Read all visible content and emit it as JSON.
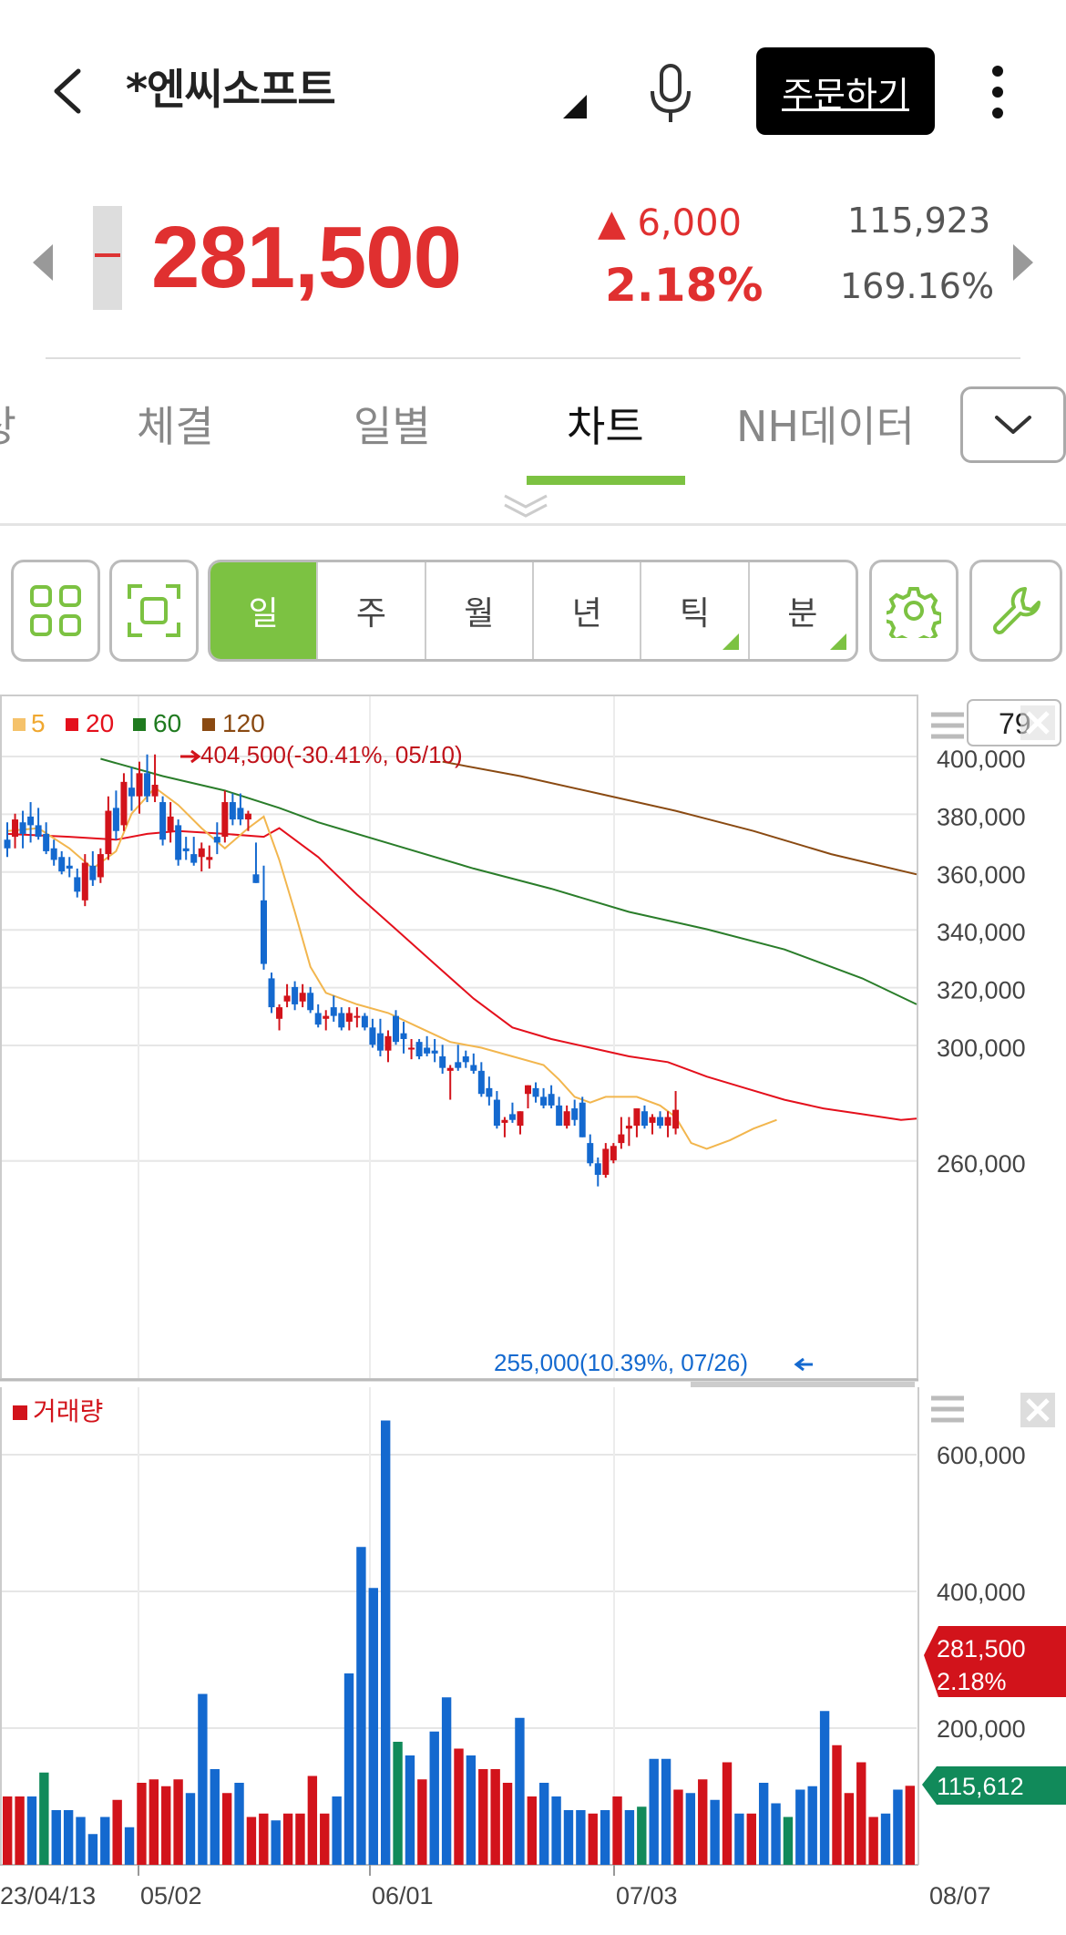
{
  "header": {
    "stock_name": "*엔씨소프트",
    "order_label": "주문하기"
  },
  "quote": {
    "price": "281,500",
    "change": "▲ 6,000",
    "change_rate": "2.18%",
    "volume": "115,923",
    "volume_rate": "169.16%"
  },
  "tabs": [
    "상",
    "체결",
    "일별",
    "차트",
    "NH데이터"
  ],
  "active_tab": "차트",
  "toolbar": {
    "periods": [
      {
        "label": "일",
        "active": true,
        "corner": false
      },
      {
        "label": "주",
        "active": false,
        "corner": false
      },
      {
        "label": "월",
        "active": false,
        "corner": false
      },
      {
        "label": "년",
        "active": false,
        "corner": false
      },
      {
        "label": "틱",
        "active": false,
        "corner": true
      },
      {
        "label": "분",
        "active": false,
        "corner": true
      }
    ]
  },
  "colors": {
    "up": "#d2131b",
    "down": "#1469cf",
    "accent": "#7cc242",
    "ma5": "#f2b64e",
    "ma20": "#e4101c",
    "ma60": "#2a7d2a",
    "ma120": "#8a4a12"
  },
  "chart_data": [
    {
      "type": "candlestick",
      "legend": [
        {
          "label": "5",
          "color": "#f5c26b"
        },
        {
          "label": "20",
          "color": "#e4101c"
        },
        {
          "label": "60",
          "color": "#1f7a1f"
        },
        {
          "label": "120",
          "color": "#8a4a12"
        }
      ],
      "count_box": "79",
      "ylim": [
        250000,
        417000
      ],
      "y_ticks": [
        "400,000",
        "380,000",
        "360,000",
        "340,000",
        "320,000",
        "300,000",
        "260,000"
      ],
      "current_price": "281,500",
      "current_rate": "2.18%",
      "high_annotation": "404,500(-30.41%, 05/10)",
      "low_annotation": "255,000(10.39%, 07/26)",
      "candles": [
        [
          375000,
          381000,
          369000,
          372000
        ],
        [
          376000,
          384000,
          372000,
          382000
        ],
        [
          381000,
          385000,
          372000,
          377000
        ],
        [
          383000,
          388000,
          374000,
          380000
        ],
        [
          380000,
          386000,
          375000,
          376000
        ],
        [
          377000,
          381000,
          370000,
          371000
        ],
        [
          372000,
          375000,
          366000,
          368000
        ],
        [
          369000,
          371000,
          363000,
          364000
        ],
        [
          366000,
          369000,
          362000,
          365000
        ],
        [
          362000,
          365000,
          355000,
          357000
        ],
        [
          354000,
          370000,
          352000,
          367000
        ],
        [
          366000,
          371000,
          359000,
          361000
        ],
        [
          362000,
          372000,
          360000,
          370000
        ],
        [
          370000,
          390000,
          368000,
          385000
        ],
        [
          386000,
          392000,
          375000,
          378000
        ],
        [
          380000,
          398000,
          378000,
          395000
        ],
        [
          393000,
          400000,
          385000,
          390000
        ],
        [
          390000,
          402000,
          384000,
          398000
        ],
        [
          398000,
          404500,
          388000,
          390000
        ],
        [
          390000,
          404500,
          388000,
          394000
        ],
        [
          388000,
          390000,
          373000,
          375000
        ],
        [
          378000,
          388000,
          374000,
          383000
        ],
        [
          380000,
          382000,
          366000,
          368000
        ],
        [
          372000,
          376000,
          368000,
          371000
        ],
        [
          370000,
          376000,
          366000,
          367000
        ],
        [
          369000,
          374000,
          364000,
          372000
        ],
        [
          368000,
          373000,
          365000,
          369000
        ],
        [
          376000,
          381000,
          370000,
          374000
        ],
        [
          376000,
          392000,
          374000,
          388000
        ],
        [
          388000,
          391000,
          380000,
          382000
        ],
        [
          386000,
          391000,
          380000,
          382000
        ],
        [
          382000,
          385000,
          378000,
          384000
        ],
        [
          363000,
          374000,
          360000,
          360000
        ],
        [
          354000,
          366000,
          330000,
          332000
        ],
        [
          327000,
          329000,
          315000,
          317000
        ],
        [
          313000,
          318000,
          309000,
          317000
        ],
        [
          319000,
          325000,
          317000,
          321000
        ],
        [
          324000,
          326000,
          316000,
          318000
        ],
        [
          319000,
          325000,
          317000,
          322000
        ],
        [
          322000,
          324000,
          315000,
          316000
        ],
        [
          315000,
          318000,
          310000,
          311000
        ],
        [
          313000,
          316000,
          309000,
          314000
        ],
        [
          317000,
          321000,
          312000,
          314000
        ],
        [
          315000,
          317000,
          309000,
          310000
        ],
        [
          312000,
          317000,
          309000,
          315000
        ],
        [
          314000,
          317000,
          310000,
          314000
        ],
        [
          314000,
          315000,
          309000,
          310000
        ],
        [
          310000,
          313000,
          303000,
          304000
        ],
        [
          308000,
          313000,
          300000,
          302000
        ],
        [
          302000,
          309000,
          298000,
          307000
        ],
        [
          314000,
          316000,
          304000,
          305000
        ],
        [
          308000,
          312000,
          301000,
          306000
        ],
        [
          303000,
          306000,
          299000,
          303000
        ],
        [
          305000,
          306000,
          299000,
          300000
        ],
        [
          303000,
          307000,
          300000,
          301000
        ],
        [
          302000,
          306000,
          298000,
          301000
        ],
        [
          300000,
          304000,
          294000,
          296000
        ],
        [
          295000,
          297000,
          285000,
          296000
        ],
        [
          298000,
          304000,
          295000,
          296000
        ],
        [
          300000,
          302000,
          296000,
          298000
        ],
        [
          297000,
          301000,
          294000,
          295000
        ],
        [
          295000,
          298000,
          286000,
          287000
        ],
        [
          289000,
          293000,
          283000,
          286000
        ],
        [
          285000,
          288000,
          275000,
          276000
        ],
        [
          277000,
          279000,
          272000,
          278000
        ],
        [
          280000,
          284000,
          277000,
          278000
        ],
        [
          276000,
          281000,
          273000,
          281000
        ],
        [
          287000,
          290000,
          282000,
          290000
        ],
        [
          289000,
          291000,
          284000,
          286000
        ],
        [
          286000,
          289000,
          282000,
          283000
        ],
        [
          287000,
          290000,
          282000,
          283000
        ],
        [
          283000,
          286000,
          276000,
          276000
        ],
        [
          276000,
          283000,
          275000,
          281000
        ],
        [
          282000,
          285000,
          276000,
          278000
        ],
        [
          284000,
          286000,
          272000,
          272000
        ],
        [
          270000,
          273000,
          262000,
          263000
        ],
        [
          263000,
          265000,
          255000,
          259000
        ],
        [
          259000,
          270000,
          258000,
          268000
        ],
        [
          264000,
          270000,
          263000,
          269000
        ],
        [
          270000,
          279000,
          268000,
          273000
        ],
        [
          275000,
          279000,
          269000,
          276000
        ],
        [
          276000,
          282000,
          272000,
          282000
        ],
        [
          281000,
          283000,
          275000,
          276000
        ],
        [
          277000,
          280000,
          273000,
          279000
        ],
        [
          279000,
          281000,
          275000,
          276000
        ],
        [
          276000,
          281000,
          272000,
          279000
        ],
        [
          275000,
          288000,
          273000,
          281500
        ]
      ],
      "ma5": [
        [
          0,
          378000
        ],
        [
          4,
          379000
        ],
        [
          8,
          372000
        ],
        [
          11,
          365000
        ],
        [
          14,
          371000
        ],
        [
          16,
          384000
        ],
        [
          19,
          393000
        ],
        [
          22,
          387000
        ],
        [
          25,
          379000
        ],
        [
          28,
          372000
        ],
        [
          31,
          379000
        ],
        [
          33,
          383000
        ],
        [
          35,
          368000
        ],
        [
          37,
          350000
        ],
        [
          39,
          331000
        ],
        [
          41,
          322000
        ],
        [
          45,
          318000
        ],
        [
          49,
          315000
        ],
        [
          53,
          310000
        ],
        [
          57,
          305000
        ],
        [
          61,
          303000
        ],
        [
          65,
          300000
        ],
        [
          69,
          297000
        ],
        [
          71,
          292000
        ],
        [
          73,
          286000
        ],
        [
          75,
          284000
        ],
        [
          77,
          286000
        ],
        [
          81,
          286000
        ],
        [
          84,
          283000
        ],
        [
          86,
          279000
        ],
        [
          88,
          270000
        ],
        [
          90,
          268000
        ],
        [
          93,
          271000
        ],
        [
          96,
          275000
        ],
        [
          99,
          278000
        ]
      ],
      "ma20": [
        [
          0,
          377000
        ],
        [
          8,
          376000
        ],
        [
          14,
          375000
        ],
        [
          18,
          377000
        ],
        [
          22,
          378000
        ],
        [
          28,
          377000
        ],
        [
          33,
          376000
        ],
        [
          35,
          379000
        ],
        [
          40,
          369000
        ],
        [
          45,
          356000
        ],
        [
          50,
          344000
        ],
        [
          55,
          332000
        ],
        [
          60,
          320000
        ],
        [
          65,
          310000
        ],
        [
          70,
          306000
        ],
        [
          75,
          303000
        ],
        [
          80,
          300000
        ],
        [
          85,
          298000
        ],
        [
          90,
          293000
        ],
        [
          95,
          289000
        ],
        [
          100,
          285000
        ],
        [
          105,
          282000
        ],
        [
          110,
          280000
        ],
        [
          115,
          278000
        ],
        [
          117,
          278500
        ]
      ],
      "ma60": [
        [
          12,
          403000
        ],
        [
          20,
          397000
        ],
        [
          28,
          392000
        ],
        [
          35,
          386000
        ],
        [
          40,
          381000
        ],
        [
          50,
          373000
        ],
        [
          60,
          365000
        ],
        [
          70,
          358000
        ],
        [
          80,
          350000
        ],
        [
          90,
          344000
        ],
        [
          100,
          337000
        ],
        [
          110,
          327000
        ],
        [
          117,
          318000
        ]
      ],
      "ma120": [
        [
          56,
          402000
        ],
        [
          66,
          397000
        ],
        [
          76,
          391000
        ],
        [
          86,
          385000
        ],
        [
          96,
          378000
        ],
        [
          106,
          370000
        ],
        [
          117,
          363000
        ]
      ]
    },
    {
      "type": "bar",
      "legend": [
        {
          "label": "거래량",
          "color": "#d2131b"
        }
      ],
      "count_box": "",
      "ylim": [
        0,
        700000
      ],
      "y_ticks": [
        "600,000",
        "400,000",
        "200,000"
      ],
      "current_value": "115,612",
      "x_ticks": [
        "23/04/13",
        "05/02",
        "06/01",
        "07/03",
        "08/07"
      ],
      "volumes": [
        [
          100000,
          "u"
        ],
        [
          100000,
          "u"
        ],
        [
          100000,
          "d"
        ],
        [
          135000,
          "g"
        ],
        [
          80000,
          "d"
        ],
        [
          80000,
          "d"
        ],
        [
          70000,
          "d"
        ],
        [
          45000,
          "d"
        ],
        [
          70000,
          "d"
        ],
        [
          95000,
          "u"
        ],
        [
          55000,
          "d"
        ],
        [
          120000,
          "u"
        ],
        [
          125000,
          "u"
        ],
        [
          115000,
          "u"
        ],
        [
          125000,
          "u"
        ],
        [
          105000,
          "d"
        ],
        [
          250000,
          "d"
        ],
        [
          140000,
          "d"
        ],
        [
          105000,
          "u"
        ],
        [
          120000,
          "d"
        ],
        [
          70000,
          "u"
        ],
        [
          75000,
          "u"
        ],
        [
          65000,
          "d"
        ],
        [
          75000,
          "u"
        ],
        [
          75000,
          "u"
        ],
        [
          130000,
          "u"
        ],
        [
          75000,
          "u"
        ],
        [
          100000,
          "d"
        ],
        [
          280000,
          "d"
        ],
        [
          465000,
          "d"
        ],
        [
          405000,
          "d"
        ],
        [
          650000,
          "d"
        ],
        [
          180000,
          "g"
        ],
        [
          160000,
          "d"
        ],
        [
          125000,
          "u"
        ],
        [
          195000,
          "d"
        ],
        [
          245000,
          "d"
        ],
        [
          170000,
          "u"
        ],
        [
          160000,
          "d"
        ],
        [
          140000,
          "u"
        ],
        [
          140000,
          "u"
        ],
        [
          120000,
          "u"
        ],
        [
          215000,
          "d"
        ],
        [
          100000,
          "u"
        ],
        [
          120000,
          "d"
        ],
        [
          100000,
          "d"
        ],
        [
          80000,
          "d"
        ],
        [
          80000,
          "d"
        ],
        [
          75000,
          "u"
        ],
        [
          80000,
          "d"
        ],
        [
          100000,
          "u"
        ],
        [
          80000,
          "d"
        ],
        [
          85000,
          "g"
        ],
        [
          155000,
          "d"
        ],
        [
          155000,
          "d"
        ],
        [
          110000,
          "u"
        ],
        [
          105000,
          "d"
        ],
        [
          125000,
          "u"
        ],
        [
          95000,
          "d"
        ],
        [
          150000,
          "u"
        ],
        [
          75000,
          "d"
        ],
        [
          75000,
          "u"
        ],
        [
          120000,
          "d"
        ],
        [
          90000,
          "d"
        ],
        [
          70000,
          "g"
        ],
        [
          110000,
          "d"
        ],
        [
          115000,
          "d"
        ],
        [
          225000,
          "d"
        ],
        [
          175000,
          "u"
        ],
        [
          105000,
          "u"
        ],
        [
          150000,
          "u"
        ],
        [
          70000,
          "u"
        ],
        [
          75000,
          "d"
        ],
        [
          110000,
          "d"
        ],
        [
          115612,
          "u"
        ]
      ]
    }
  ]
}
